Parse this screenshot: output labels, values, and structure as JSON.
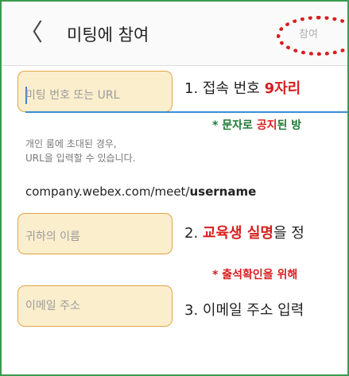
{
  "header": {
    "back_icon": "chevron-left-icon",
    "back_glyph": "〈",
    "title": "미팅에 참여",
    "join_label": "참여"
  },
  "fields": {
    "meeting_number": {
      "placeholder": "미팅 번호 또는 URL"
    },
    "name": {
      "placeholder": "귀하의 이름"
    },
    "email": {
      "placeholder": "이메일 주소"
    }
  },
  "helper": {
    "line1": "개인 룸에 초대된 경우,",
    "line2": "URL을 입력할 수 있습니다."
  },
  "url_hint": {
    "prefix": "company.webex.com/meet/",
    "username": "username"
  },
  "annotations": {
    "step1": {
      "text": "1. 접속 번호 ",
      "highlight": "9자리"
    },
    "note1": {
      "text": "* 문자로 ",
      "highlight": "공지",
      "suffix": "된 방"
    },
    "step2": {
      "text": "2. ",
      "highlight": "교육생 실명",
      "suffix": "을 정"
    },
    "note2": {
      "text": "* 출석확인을 위해"
    },
    "step3": {
      "text": "3. 이메일 주소 입력"
    }
  },
  "colors": {
    "annotation_red": "#d81e1e",
    "note_green": "#1f7a35",
    "highlight_fill": "#fbeecd",
    "highlight_border": "#e0a645",
    "frame_green": "#3a9b4c",
    "input_underline": "#3a8ed6"
  }
}
